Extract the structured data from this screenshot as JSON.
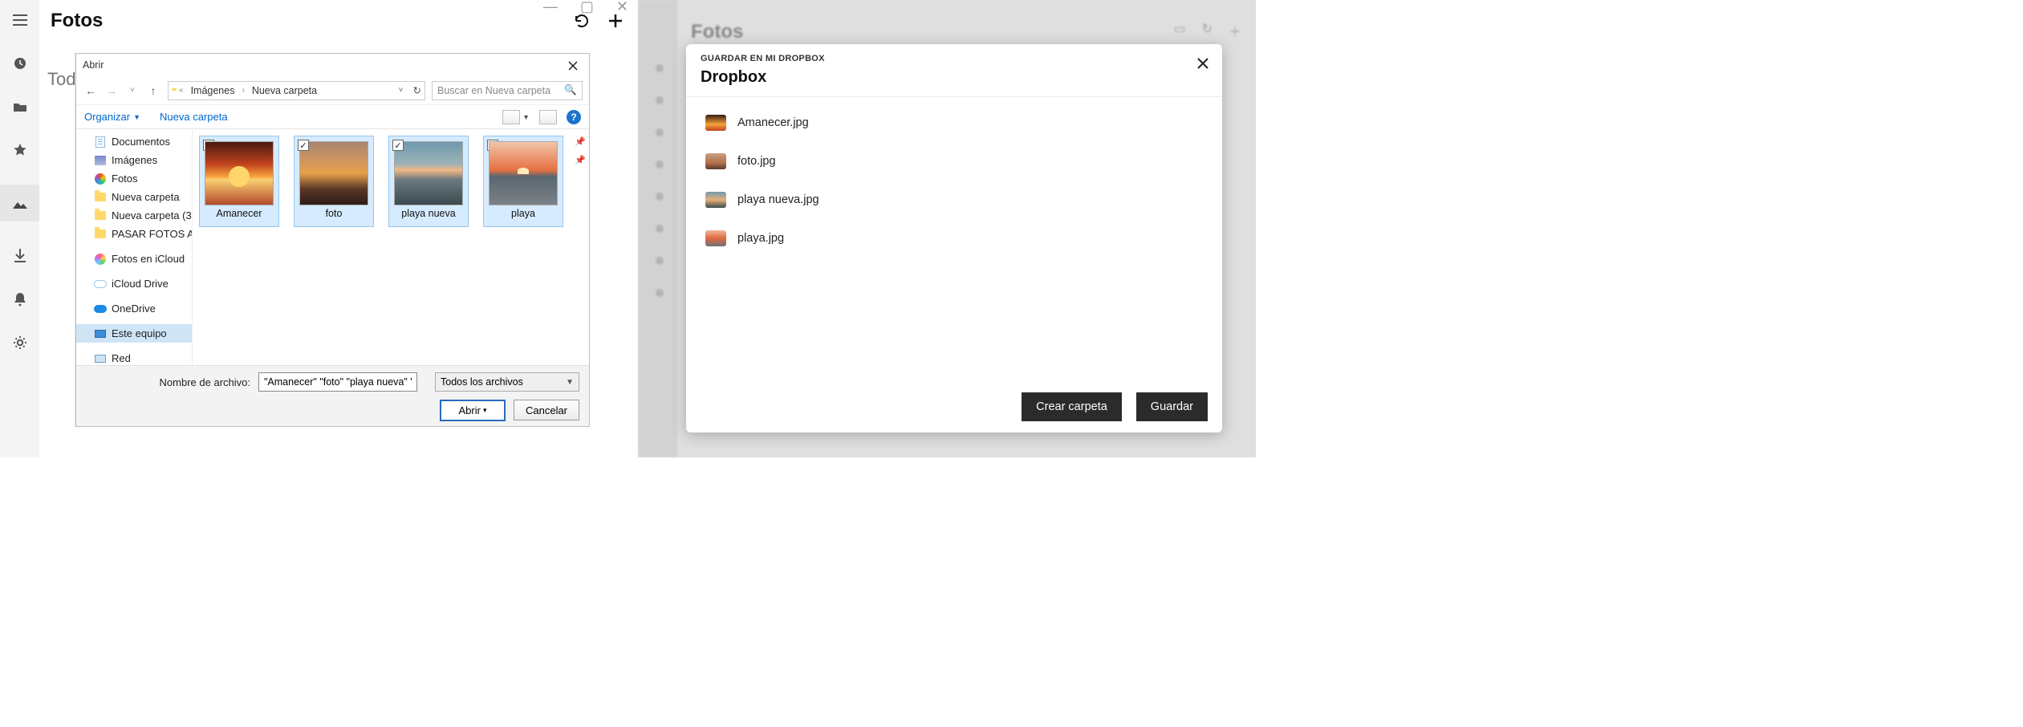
{
  "left": {
    "app": {
      "title": "Fotos",
      "subtitle_partial": "Today",
      "win_controls": {
        "min": "—",
        "max": "▢",
        "close": "✕"
      }
    },
    "dialog": {
      "title": "Abrir",
      "nav": {
        "back": "←",
        "forward": "→",
        "up": "↑",
        "location_prefix": "«",
        "path": [
          "Imágenes",
          "Nueva carpeta"
        ],
        "dropdown": "˅",
        "refresh": "↻"
      },
      "search_placeholder": "Buscar en Nueva carpeta",
      "toolbar": {
        "organize": "Organizar",
        "newfolder": "Nueva carpeta"
      },
      "tree": [
        {
          "icon": "doc",
          "label": "Documentos",
          "pinned": true
        },
        {
          "icon": "picture",
          "label": "Imágenes",
          "pinned": true
        },
        {
          "icon": "fotos",
          "label": "Fotos"
        },
        {
          "icon": "folder",
          "label": "Nueva carpeta"
        },
        {
          "icon": "folder",
          "label": "Nueva carpeta (3"
        },
        {
          "icon": "folder",
          "label": "PASAR FOTOS AL"
        },
        {
          "gap": true
        },
        {
          "icon": "icloudp",
          "label": "Fotos en iCloud"
        },
        {
          "gap": true
        },
        {
          "icon": "icloudd",
          "label": "iCloud Drive"
        },
        {
          "gap": true
        },
        {
          "icon": "onedrive",
          "label": "OneDrive"
        },
        {
          "gap": true
        },
        {
          "icon": "pc",
          "label": "Este equipo",
          "selected": true
        },
        {
          "gap": true
        },
        {
          "icon": "network",
          "label": "Red"
        }
      ],
      "thumbs": [
        {
          "name": "Amanecer",
          "checked": true,
          "style": "sun1"
        },
        {
          "name": "foto",
          "checked": true,
          "style": "sun2"
        },
        {
          "name": "playa nueva",
          "checked": true,
          "style": "sun3"
        },
        {
          "name": "playa",
          "checked": true,
          "style": "sun4"
        }
      ],
      "footer": {
        "filename_label": "Nombre de archivo:",
        "filename_value": "\"Amanecer\" \"foto\" \"playa nueva\" \"p",
        "filetype": "Todos los archivos",
        "open": "Abrir",
        "cancel": "Cancelar"
      }
    }
  },
  "right": {
    "background_title": "Fotos",
    "modal": {
      "eyebrow": "GUARDAR EN MI DROPBOX",
      "title": "Dropbox",
      "files": [
        {
          "name": "Amanecer.jpg",
          "style": "th1"
        },
        {
          "name": "foto.jpg",
          "style": "th2"
        },
        {
          "name": "playa nueva.jpg",
          "style": "th3"
        },
        {
          "name": "playa.jpg",
          "style": "th4"
        }
      ],
      "create_folder": "Crear carpeta",
      "save": "Guardar"
    }
  }
}
